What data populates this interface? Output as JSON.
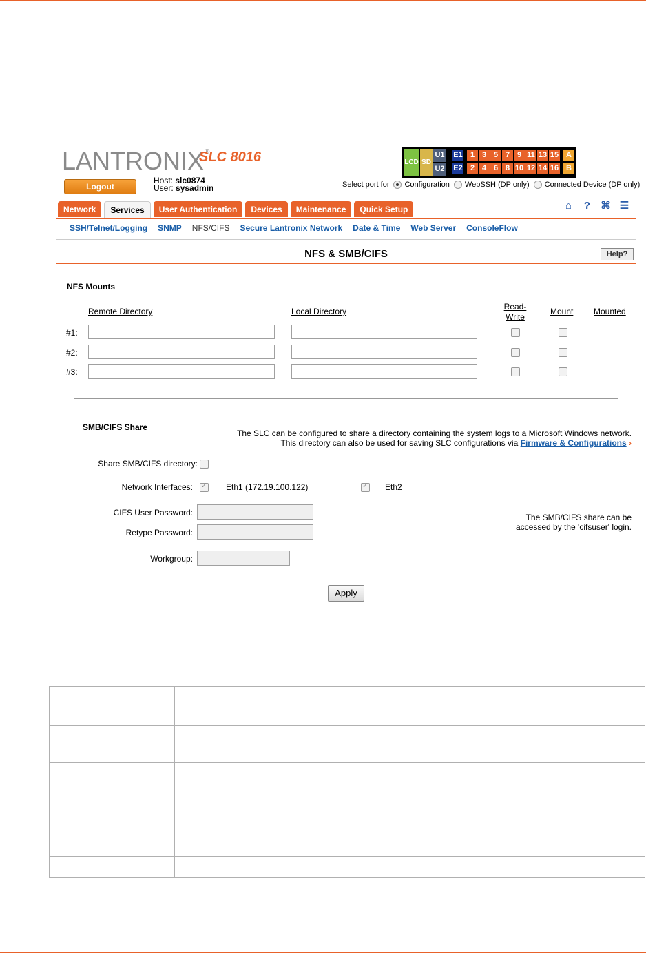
{
  "brand": {
    "logo_text": "LANTRONIX",
    "logo_reg": "®",
    "model": "SLC 8016"
  },
  "session": {
    "logout_label": "Logout",
    "host_label": "Host:",
    "host_value": "slc0874",
    "user_label": "User:",
    "user_value": "sysadmin"
  },
  "port_panel": {
    "lcd": "LCD",
    "sd": "SD",
    "u1": "U1",
    "u2": "U2",
    "e1": "E1",
    "e2": "E2",
    "top_ports": [
      "1",
      "3",
      "5",
      "7",
      "9",
      "11",
      "13",
      "15"
    ],
    "bottom_ports": [
      "2",
      "4",
      "6",
      "8",
      "10",
      "12",
      "14",
      "16"
    ],
    "a": "A",
    "b": "B"
  },
  "select_port": {
    "label": "Select port for",
    "options": [
      "Configuration",
      "WebSSH (DP only)",
      "Connected Device (DP only)"
    ],
    "selected": "Configuration"
  },
  "tabs": [
    "Network",
    "Services",
    "User Authentication",
    "Devices",
    "Maintenance",
    "Quick Setup"
  ],
  "active_tab": "Services",
  "header_icons": [
    "home-icon",
    "help-icon",
    "sitemap-icon",
    "notes-icon"
  ],
  "subnav": [
    "SSH/Telnet/Logging",
    "SNMP",
    "NFS/CIFS",
    "Secure Lantronix Network",
    "Date & Time",
    "Web Server",
    "ConsoleFlow"
  ],
  "subnav_current": "NFS/CIFS",
  "page": {
    "title": "NFS & SMB/CIFS",
    "help_label": "Help?"
  },
  "nfs": {
    "section_title": "NFS Mounts",
    "col_remote": "Remote Directory",
    "col_local": "Local Directory",
    "col_rw": "Read-Write",
    "col_mount": "Mount",
    "col_mounted": "Mounted",
    "rows": [
      {
        "label": "#1:",
        "remote": "",
        "local": "",
        "read_write": false,
        "mount": false
      },
      {
        "label": "#2:",
        "remote": "",
        "local": "",
        "read_write": false,
        "mount": false
      },
      {
        "label": "#3:",
        "remote": "",
        "local": "",
        "read_write": false,
        "mount": false
      }
    ]
  },
  "smb": {
    "section_title": "SMB/CIFS Share",
    "desc_line1": "The SLC can be configured to share a directory containing the system logs to a Microsoft Windows network.",
    "desc_line2_prefix": "This directory can also be used for saving SLC configurations via ",
    "desc_link": "Firmware & Configurations",
    "share_label": "Share SMB/CIFS directory:",
    "share_checked": false,
    "interfaces_label": "Network Interfaces:",
    "eth1_label": "Eth1 (172.19.100.122)",
    "eth1_checked": true,
    "eth2_label": "Eth2",
    "eth2_checked": true,
    "password_label": "CIFS User Password:",
    "retype_label": "Retype Password:",
    "workgroup_label": "Workgroup:",
    "note_line1": "The SMB/CIFS share can be",
    "note_line2": "accessed by the 'cifsuser' login.",
    "apply_label": "Apply"
  }
}
